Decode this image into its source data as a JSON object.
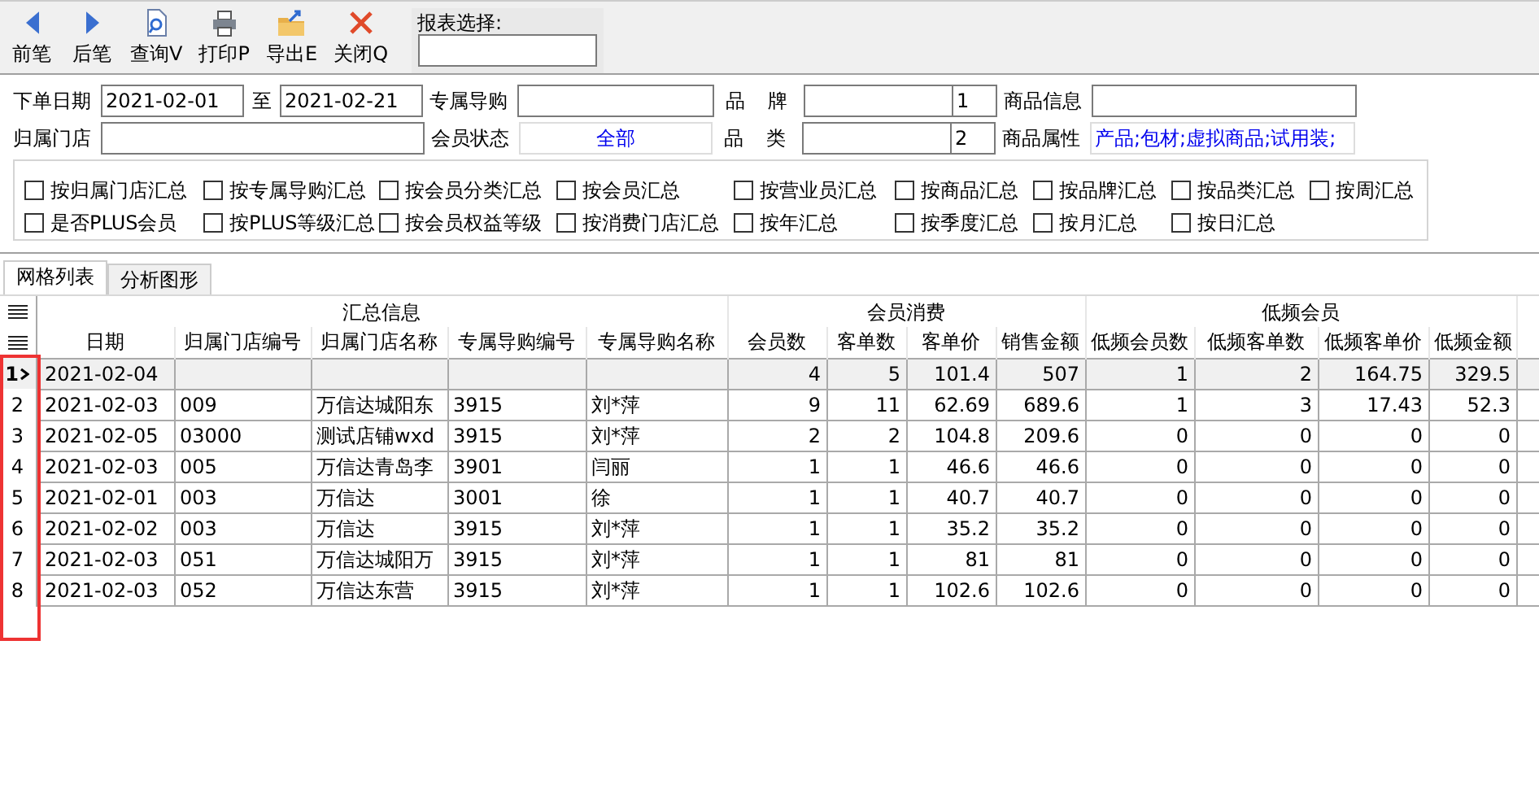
{
  "toolbar": {
    "buttons": [
      {
        "label": "前笔",
        "kind": "prev"
      },
      {
        "label": "后笔",
        "kind": "next"
      },
      {
        "label": "查询V",
        "kind": "query"
      },
      {
        "label": "打印P",
        "kind": "print"
      },
      {
        "label": "导出E",
        "kind": "export"
      },
      {
        "label": "关闭Q",
        "kind": "close"
      }
    ],
    "report_select": {
      "label": "报表选择:"
    }
  },
  "filters": [
    [
      {
        "kind": "label",
        "text": "下单日期"
      },
      {
        "kind": "date",
        "value": "2021-02-01"
      },
      {
        "kind": "sep",
        "text": "至"
      },
      {
        "kind": "date",
        "value": "2021-02-21"
      },
      {
        "kind": "label",
        "text": "专属导购"
      },
      {
        "kind": "text"
      },
      {
        "kind": "spread",
        "text": "品 牌"
      },
      {
        "kind": "pair",
        "code": "1"
      },
      {
        "kind": "label",
        "text": "商品信息"
      },
      {
        "kind": "long"
      }
    ],
    [
      {
        "kind": "label",
        "text": "归属门店"
      },
      {
        "kind": "wide"
      },
      {
        "kind": "label",
        "text": "会员状态"
      },
      {
        "kind": "select",
        "value": "全部"
      },
      {
        "kind": "spread",
        "text": "品 类"
      },
      {
        "kind": "pair",
        "code": "2"
      },
      {
        "kind": "label",
        "text": "商品属性"
      },
      {
        "kind": "attr",
        "value": "产品;包材;虚拟商品;试用装;"
      }
    ]
  ],
  "group_options": [
    {
      "label": "按归属门店汇总",
      "checked": false
    },
    {
      "label": "按专属导购汇总",
      "checked": false
    },
    {
      "label": "按会员分类汇总",
      "checked": false
    },
    {
      "label": "按会员汇总",
      "checked": false
    },
    {
      "label": "按营业员汇总",
      "checked": false
    },
    {
      "label": "按商品汇总",
      "checked": false
    },
    {
      "label": "按品牌汇总",
      "checked": false
    },
    {
      "label": "按品类汇总",
      "checked": false
    },
    {
      "label": "按周汇总",
      "checked": false
    },
    {
      "label": "是否PLUS会员",
      "checked": false
    },
    {
      "label": "按PLUS等级汇总",
      "checked": false
    },
    {
      "label": "按会员权益等级",
      "checked": false
    },
    {
      "label": "按消费门店汇总",
      "checked": false
    },
    {
      "label": "按年汇总",
      "checked": false
    },
    {
      "label": "按季度汇总",
      "checked": false
    },
    {
      "label": "按月汇总",
      "checked": false
    },
    {
      "label": "按日汇总",
      "checked": false
    }
  ],
  "tabs": [
    {
      "label": "网格列表",
      "selected": true
    },
    {
      "label": "分析图形",
      "selected": false
    }
  ],
  "table": {
    "groups": [
      {
        "label": "汇总信息",
        "columns": [
          {
            "label": "日期",
            "kind": "text"
          },
          {
            "label": "归属门店编号",
            "kind": "text"
          },
          {
            "label": "归属门店名称",
            "kind": "text"
          },
          {
            "label": "专属导购编号",
            "kind": "text"
          },
          {
            "label": "专属导购名称",
            "kind": "text"
          }
        ]
      },
      {
        "label": "会员消费",
        "columns": [
          {
            "label": "会员数",
            "kind": "number"
          },
          {
            "label": "客单数",
            "kind": "number"
          },
          {
            "label": "客单价",
            "kind": "number"
          },
          {
            "label": "销售金额",
            "kind": "number"
          }
        ]
      },
      {
        "label": "低频会员",
        "columns": [
          {
            "label": "低频会员数",
            "kind": "number"
          },
          {
            "label": "低频客单数",
            "kind": "number"
          },
          {
            "label": "低频客单价",
            "kind": "number"
          },
          {
            "label": "低频金额",
            "kind": "number"
          }
        ]
      }
    ],
    "rows": [
      {
        "number": "1",
        "selected": true,
        "cells": [
          "2021-02-04",
          null,
          null,
          null,
          null,
          "4",
          "5",
          "101.4",
          "507",
          "1",
          "2",
          "164.75",
          "329.5"
        ]
      },
      {
        "number": "2",
        "selected": false,
        "cells": [
          "2021-02-03",
          "009",
          "万信达城阳东",
          "3915",
          "刘*萍",
          "9",
          "11",
          "62.69",
          "689.6",
          "1",
          "3",
          "17.43",
          "52.3"
        ]
      },
      {
        "number": "3",
        "selected": false,
        "cells": [
          "2021-02-05",
          "03000",
          "测试店铺wxd",
          "3915",
          "刘*萍",
          "2",
          "2",
          "104.8",
          "209.6",
          "0",
          "0",
          "0",
          "0"
        ]
      },
      {
        "number": "4",
        "selected": false,
        "cells": [
          "2021-02-03",
          "005",
          "万信达青岛李",
          "3901",
          "闫丽",
          "1",
          "1",
          "46.6",
          "46.6",
          "0",
          "0",
          "0",
          "0"
        ]
      },
      {
        "number": "5",
        "selected": false,
        "cells": [
          "2021-02-01",
          "003",
          "万信达",
          "3001",
          "徐",
          "1",
          "1",
          "40.7",
          "40.7",
          "0",
          "0",
          "0",
          "0"
        ]
      },
      {
        "number": "6",
        "selected": false,
        "cells": [
          "2021-02-02",
          "003",
          "万信达",
          "3915",
          "刘*萍",
          "1",
          "1",
          "35.2",
          "35.2",
          "0",
          "0",
          "0",
          "0"
        ]
      },
      {
        "number": "7",
        "selected": false,
        "cells": [
          "2021-02-03",
          "051",
          "万信达城阳万",
          "3915",
          "刘*萍",
          "1",
          "1",
          "81",
          "81",
          "0",
          "0",
          "0",
          "0"
        ]
      },
      {
        "number": "8",
        "selected": false,
        "cells": [
          "2021-02-03",
          "052",
          "万信达东营",
          "3915",
          "刘*萍",
          "1",
          "1",
          "102.6",
          "102.6",
          "0",
          "0",
          "0",
          "0"
        ]
      }
    ]
  },
  "annotation": {
    "kind": "rectangle",
    "color": "#ee3333"
  }
}
